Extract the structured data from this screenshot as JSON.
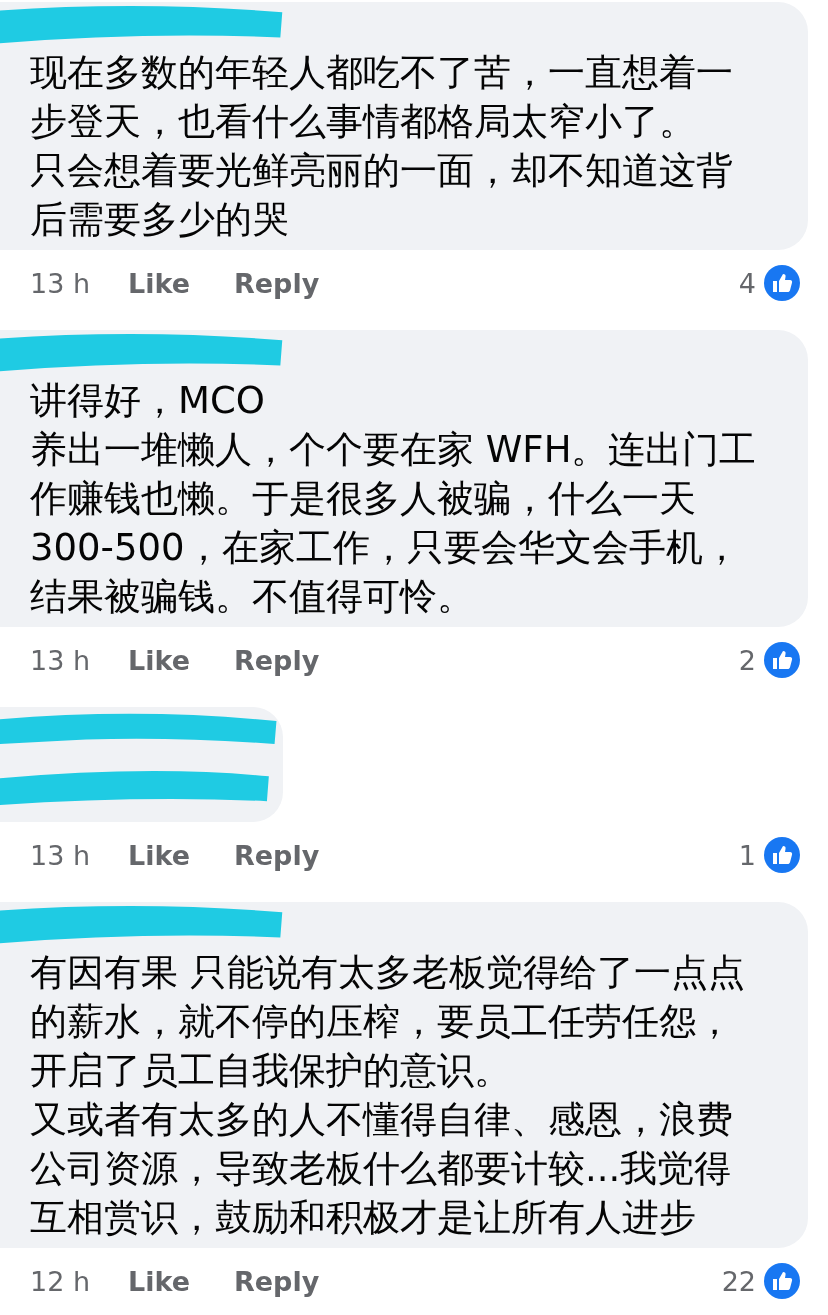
{
  "comments": [
    {
      "redacted": true,
      "paragraphs": [
        "现在多数的年轻人都吃不了苦，一直想着一步登天，也看什么事情都格局太窄小了。",
        "只会想着要光鲜亮丽的一面，却不知道这背后需要多少的哭"
      ],
      "time": "13 h",
      "like": "Like",
      "reply": "Reply",
      "reactions": "4"
    },
    {
      "redacted": true,
      "paragraphs": [
        "讲得好，MCO",
        "养出一堆懒人，个个要在家 WFH。连出门工作赚钱也懒。于是很多人被骗，什么一天300-500，在家工作，只要会华文会手机，结果被骗钱。不值得可怜。"
      ],
      "time": "13 h",
      "like": "Like",
      "reply": "Reply",
      "reactions": "2"
    },
    {
      "redacted": true,
      "time": "13 h",
      "like": "Like",
      "reply": "Reply",
      "reactions": "1"
    },
    {
      "redacted": true,
      "paragraphs": [
        "有因有果 只能说有太多老板觉得给了一点点的薪水，就不停的压榨，要员工任劳任怨，开启了员工自我保护的意识。",
        "又或者有太多的人不懂得自律、感恩，浪费公司资源，导致老板什么都要计较...我觉得互相赏识，鼓励和积极才是让所有人进步"
      ],
      "time": "12 h",
      "like": "Like",
      "reply": "Reply",
      "reactions": "22"
    }
  ]
}
